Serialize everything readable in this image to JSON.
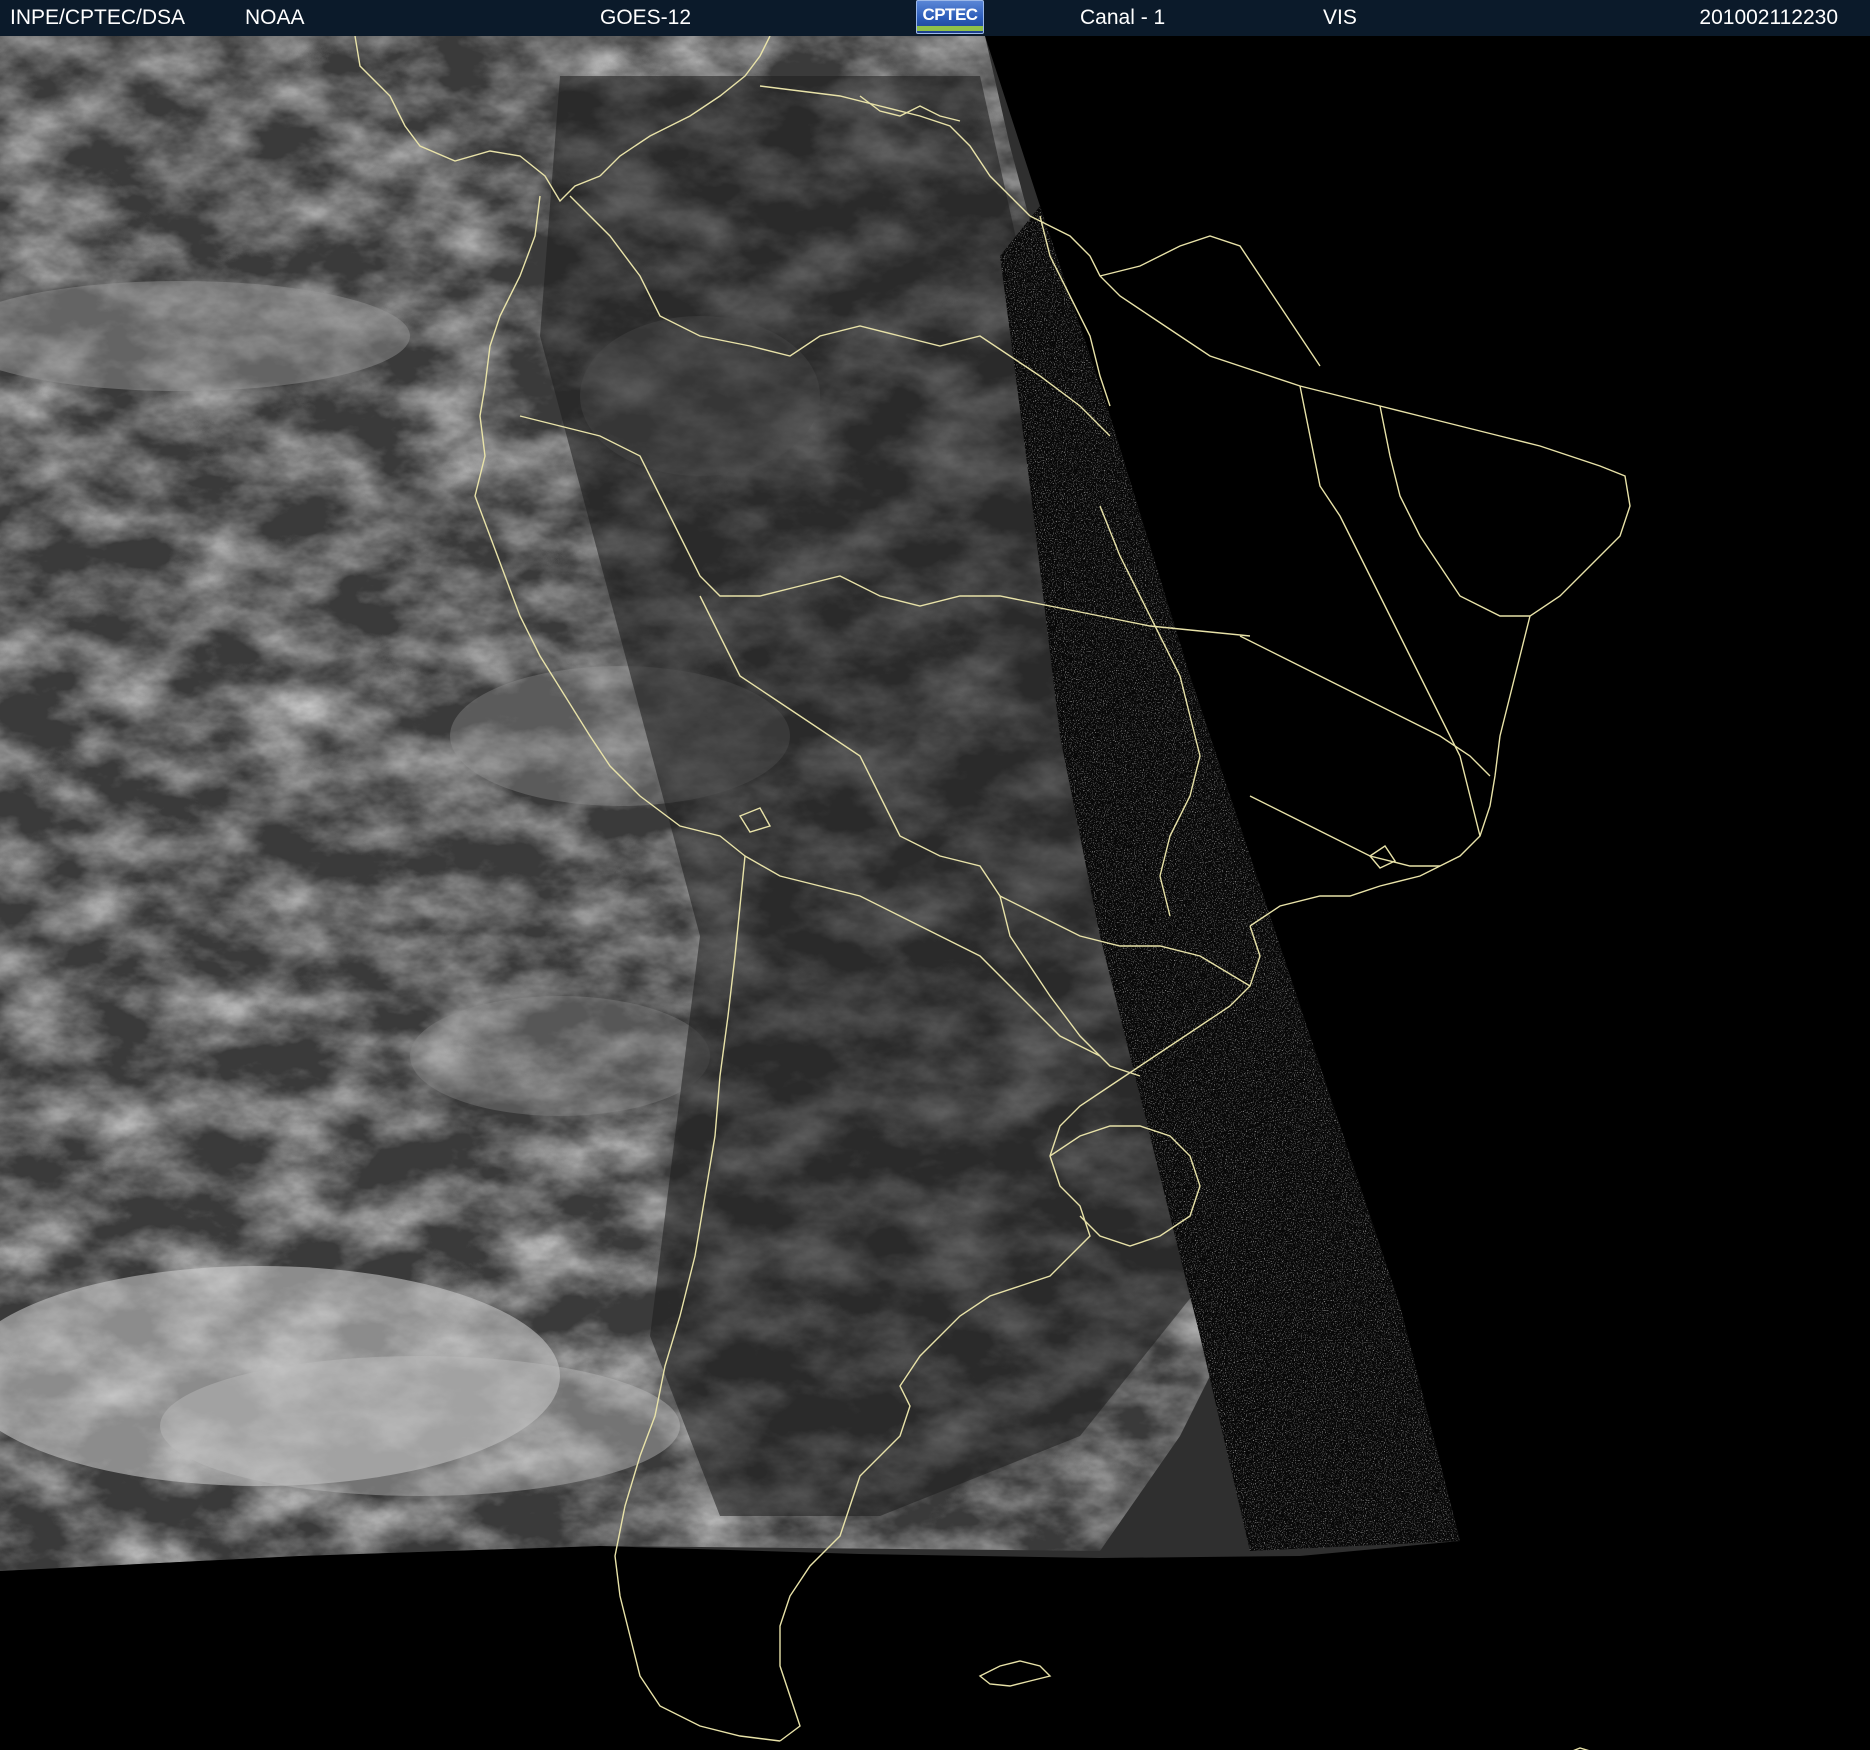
{
  "header": {
    "agency": "INPE/CPTEC/DSA",
    "source": "NOAA",
    "satellite": "GOES-12",
    "logo_text": "CPTEC",
    "channel": "Canal - 1",
    "band": "VIS",
    "timestamp": "201002112230"
  },
  "colors": {
    "header_bg": "#0b1a2a",
    "header_text": "#ffffff",
    "coastline": "#e8e2a8",
    "background": "#000000"
  },
  "image": {
    "subject": "satellite-visible-imagery-south-america"
  }
}
